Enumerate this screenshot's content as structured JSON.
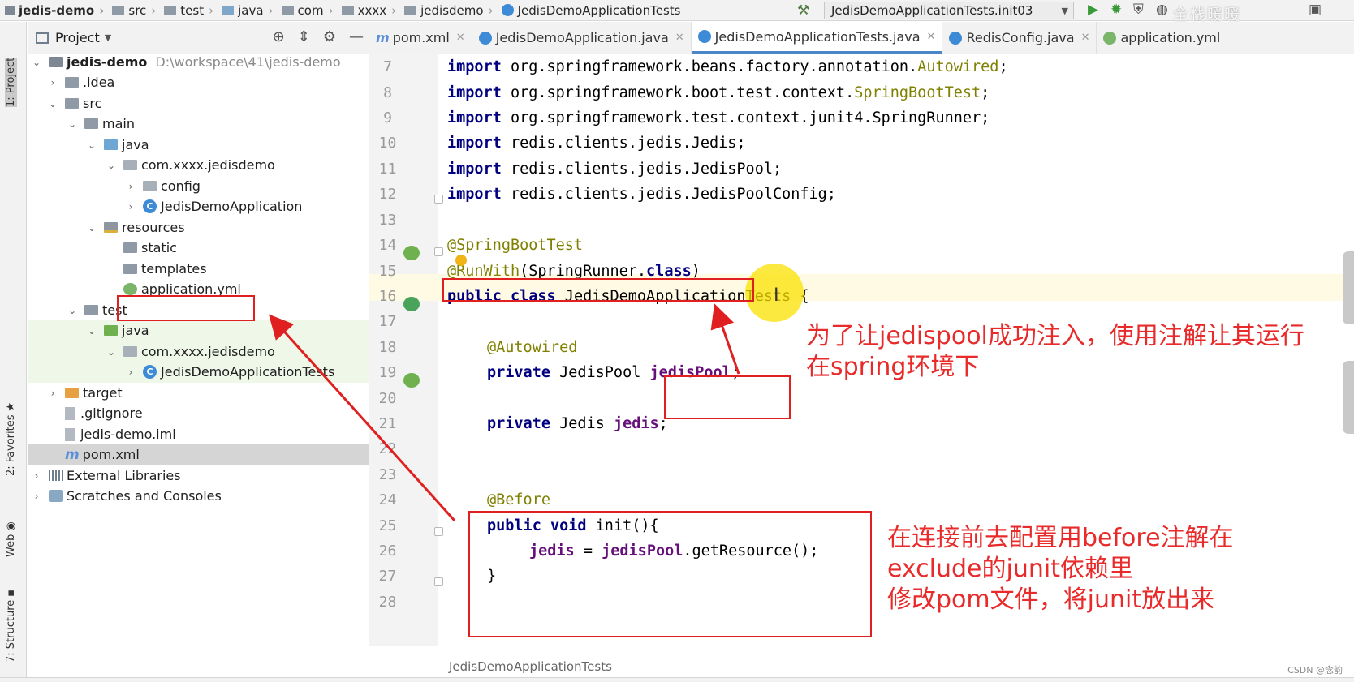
{
  "breadcrumb": [
    {
      "label": "jedis-demo"
    },
    {
      "label": "src"
    },
    {
      "label": "test"
    },
    {
      "label": "java"
    },
    {
      "label": "com"
    },
    {
      "label": "xxxx"
    },
    {
      "label": "jedisdemo"
    },
    {
      "label": "JedisDemoApplicationTests"
    }
  ],
  "toolbar": {
    "run_config": "JedisDemoApplicationTests.init03",
    "watermark": "全栈暖暖"
  },
  "side_stripe": {
    "project": "1: Project",
    "favorites": "2: Favorites",
    "web": "Web",
    "structure": "7: Structure"
  },
  "project_panel": {
    "title": "Project",
    "tree": [
      {
        "label": "jedis-demo",
        "path": "D:\\workspace\\41\\jedis-demo"
      },
      {
        "label": ".idea"
      },
      {
        "label": "src"
      },
      {
        "label": "main"
      },
      {
        "label": "java"
      },
      {
        "label": "com.xxxx.jedisdemo"
      },
      {
        "label": "config"
      },
      {
        "label": "JedisDemoApplication"
      },
      {
        "label": "resources"
      },
      {
        "label": "static"
      },
      {
        "label": "templates"
      },
      {
        "label": "application.yml"
      },
      {
        "label": "test"
      },
      {
        "label": "java"
      },
      {
        "label": "com.xxxx.jedisdemo"
      },
      {
        "label": "JedisDemoApplicationTests"
      },
      {
        "label": "target"
      },
      {
        "label": ".gitignore"
      },
      {
        "label": "jedis-demo.iml"
      },
      {
        "label": "pom.xml"
      },
      {
        "label": "External Libraries"
      },
      {
        "label": "Scratches and Consoles"
      }
    ]
  },
  "tabs": [
    {
      "label": "pom.xml"
    },
    {
      "label": "JedisDemoApplication.java"
    },
    {
      "label": "JedisDemoApplicationTests.java",
      "active": true
    },
    {
      "label": "RedisConfig.java"
    },
    {
      "label": "application.yml"
    }
  ],
  "editor": {
    "line_numbers": [
      "7",
      "8",
      "9",
      "10",
      "11",
      "12",
      "13",
      "14",
      "15",
      "16",
      "17",
      "18",
      "19",
      "20",
      "21",
      "22",
      "23",
      "24",
      "25",
      "26",
      "27",
      "28"
    ],
    "code": {
      "l7_pkg": " org.springframework.beans.factory.annotation.",
      "l7_cls": "Autowired",
      "l8_pkg": " org.springframework.boot.test.context.",
      "l8_cls": "SpringBootTest",
      "l9": " org.springframework.test.context.junit4.SpringRunner;",
      "l10": " redis.clients.jedis.Jedis;",
      "l11": " redis.clients.jedis.JedisPool;",
      "l12": " redis.clients.jedis.JedisPoolConfig;",
      "l14": "@SpringBootTest",
      "l15_ann": "@RunWith",
      "l15_rest": "(SpringRunner.",
      "l15_cls": "class",
      "l15_end": ")",
      "l16_rest": " JedisDemoApplicationTests {",
      "l18": "@Autowired",
      "l19_type": " JedisPool ",
      "l19_field": "jedisPool",
      "l21_type": " Jedis ",
      "l21_field": "jedis",
      "l24": "@Before",
      "l25_rest": " init(){",
      "l26_field": "jedis",
      "l26_eq": " = ",
      "l26_field2": "jedisPool",
      "l26_rest": ".getResource();",
      "l27": "}"
    },
    "keywords": {
      "import": "import",
      "public": "public",
      "class": "class",
      "private": "private",
      "void": "void"
    },
    "status_path": "JedisDemoApplicationTests"
  },
  "annotations": {
    "note1_line1": "为了让jedispool成功注入，使用注解让其运行",
    "note1_line2": "在spring环境下",
    "note2_line1": "在连接前去配置用before注解在",
    "note2_line2": "exclude的junit依赖里",
    "note2_line3": "修改pom文件，将junit放出来"
  },
  "footer": {
    "credit": "CSDN @念韵"
  },
  "colors": {
    "annotation_red": "#e02020",
    "keyword": "#000080",
    "annotation_code": "#808000"
  }
}
